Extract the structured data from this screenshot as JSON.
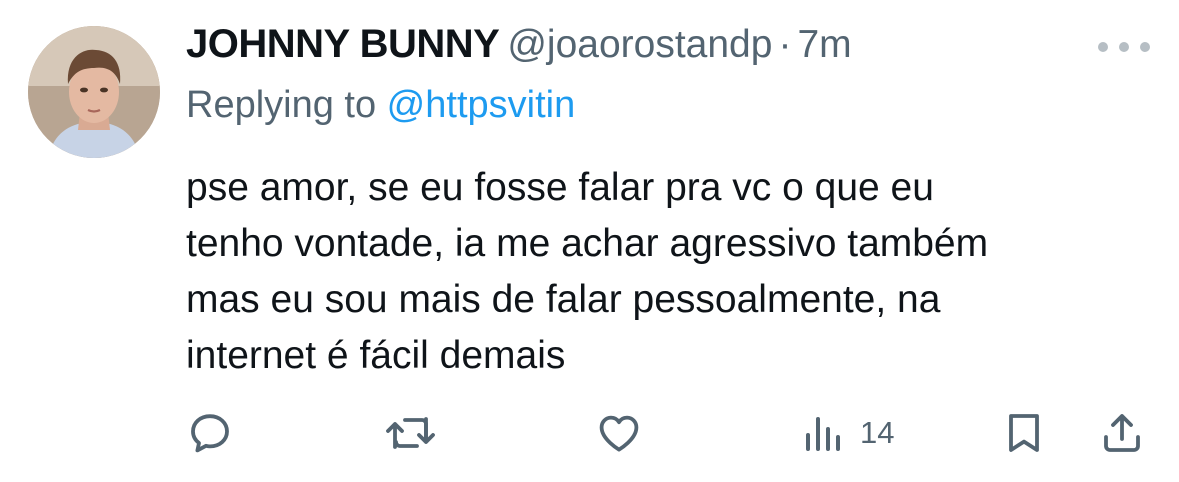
{
  "tweet": {
    "display_name": "JOHNNY BUNNY",
    "handle": "@joaorostandp",
    "separator": "·",
    "time": "7m",
    "replying_prefix": "Replying to ",
    "replying_to": "@httpsvitin",
    "body_lines": [
      "pse amor, se eu fosse falar pra vc o que eu",
      "tenho vontade, ia me achar agressivo também",
      "mas eu sou mais de falar pessoalmente, na",
      "internet é fácil demais"
    ],
    "views": "14"
  },
  "icons": {
    "more": "more-horizontal-icon",
    "reply": "reply-bubble-icon",
    "retweet": "retweet-icon",
    "like": "heart-icon",
    "views": "views-bar-chart-icon",
    "bookmark": "bookmark-icon",
    "share": "share-upload-icon"
  },
  "colors": {
    "text": "#0f1419",
    "secondary": "#536471",
    "link": "#1d9bf0",
    "more_dots": "#b6bec4"
  }
}
